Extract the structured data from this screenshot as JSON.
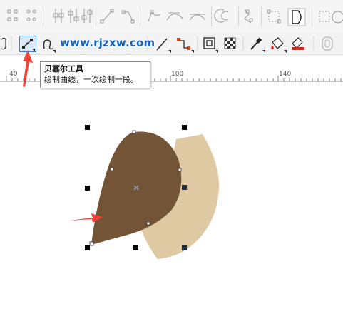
{
  "toolbar": {
    "active_tool_icon": "bezier-tool-icon",
    "watermark": "www.rjzxw.com"
  },
  "ruler": {
    "labels": [
      "40",
      "100",
      "140"
    ]
  },
  "tooltip": {
    "title": "贝塞尔工具",
    "description": "绘制曲线，一次绘制一段。"
  },
  "colors": {
    "dark_shape": "#735437",
    "light_shape": "#dfc9a2",
    "arrow": "#f0433a",
    "active_button": "#3d7fd1"
  }
}
